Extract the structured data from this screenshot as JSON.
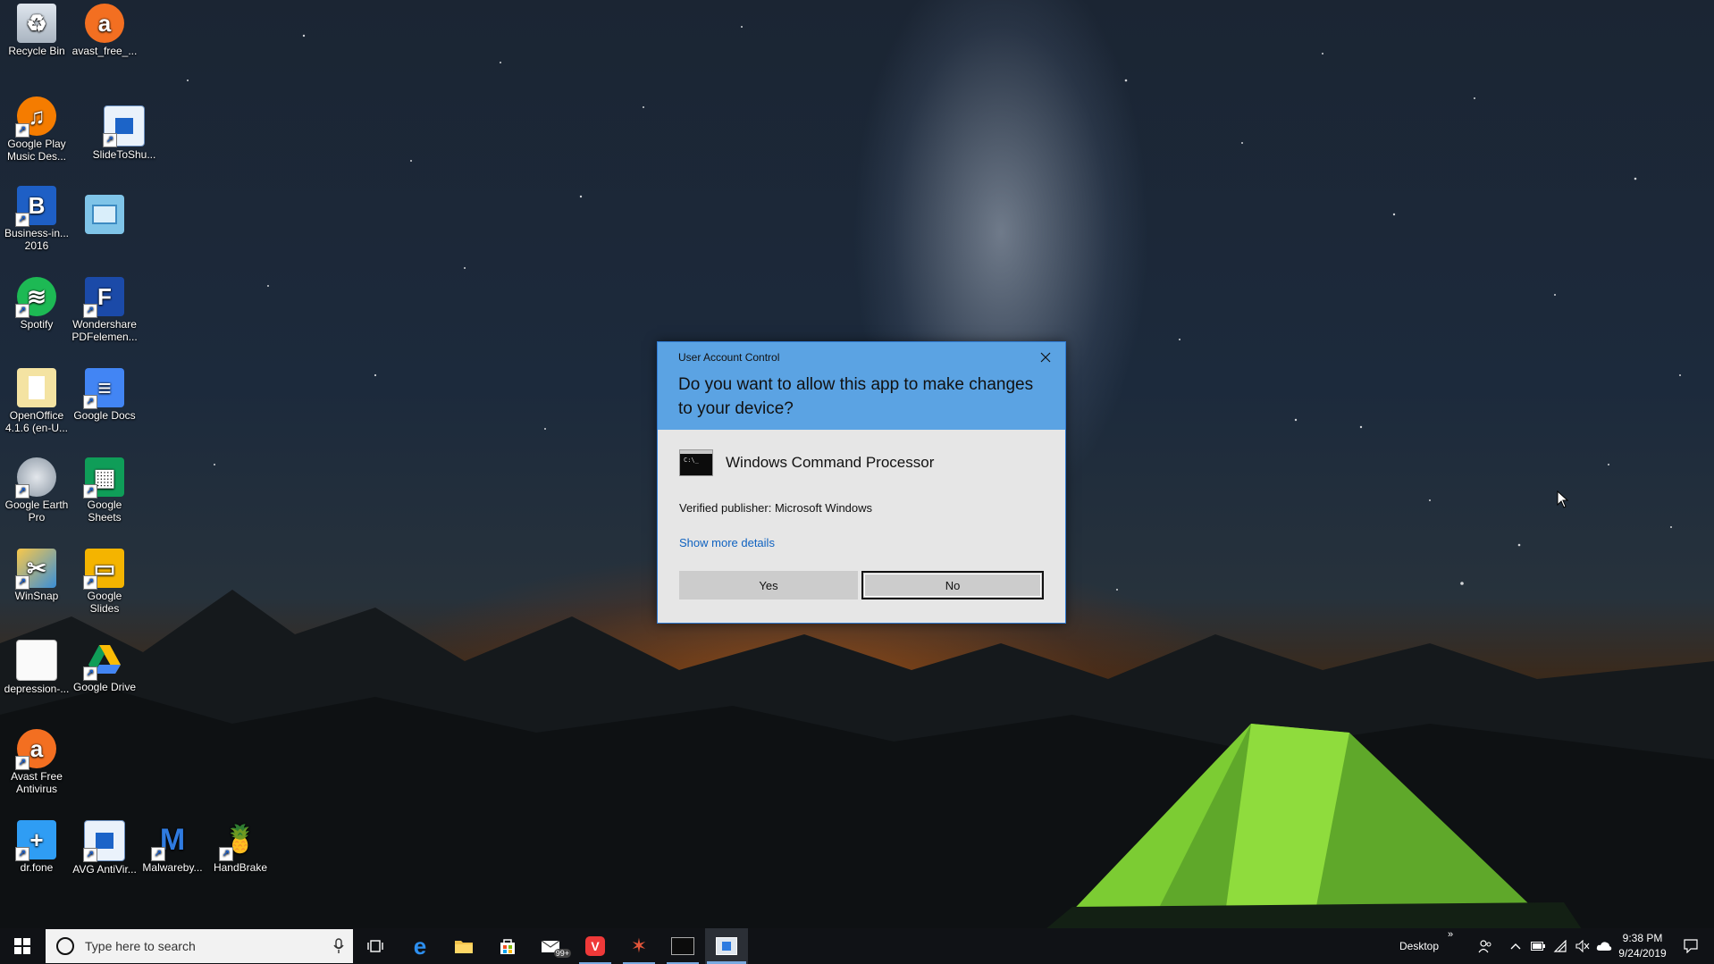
{
  "window": {
    "title": "User Account Control"
  },
  "dialog": {
    "title": "User Account Control",
    "question": "Do you want to allow this app to make changes to your device?",
    "app_name": "Windows Command Processor",
    "app_icon": "cmd-icon",
    "publisher": "Verified publisher: Microsoft Windows",
    "show_more": "Show more details",
    "yes_label": "Yes",
    "no_label": "No",
    "close_icon": "close-icon",
    "header_color": "#5ba3e3",
    "body_color": "#e6e6e6",
    "link_color": "#0f62c0"
  },
  "desktop": {
    "icons": [
      {
        "label": "Recycle Bin",
        "icon": "recycle-bin-icon"
      },
      {
        "label": "avast_free_...",
        "icon": "avast-installer-icon"
      },
      {
        "label": "Google Play Music Des...",
        "icon": "google-play-music-icon"
      },
      {
        "label": "SlideToShu...",
        "icon": "shortcut-icon"
      },
      {
        "label": "Business-in... 2016",
        "icon": "business-in-icon"
      },
      {
        "label": "",
        "icon": "control-panel-icon"
      },
      {
        "label": "Spotify",
        "icon": "spotify-icon"
      },
      {
        "label": "Wondershare PDFelemen...",
        "icon": "pdfelement-icon"
      },
      {
        "label": "OpenOffice 4.1.6 (en-U...",
        "icon": "openoffice-icon"
      },
      {
        "label": "Google Docs",
        "icon": "google-docs-icon"
      },
      {
        "label": "Google Earth Pro",
        "icon": "google-earth-icon"
      },
      {
        "label": "Google Sheets",
        "icon": "google-sheets-icon"
      },
      {
        "label": "WinSnap",
        "icon": "winsnap-icon"
      },
      {
        "label": "Google Slides",
        "icon": "google-slides-icon"
      },
      {
        "label": "depression-...",
        "icon": "document-icon"
      },
      {
        "label": "Google Drive",
        "icon": "google-drive-icon"
      },
      {
        "label": "Avast Free Antivirus",
        "icon": "avast-icon"
      },
      {
        "label": "dr.fone",
        "icon": "drfone-icon"
      },
      {
        "label": "AVG AntiVir...",
        "icon": "avg-icon"
      },
      {
        "label": "Malwareby...",
        "icon": "malwarebytes-icon"
      },
      {
        "label": "HandBrake",
        "icon": "handbrake-icon"
      }
    ]
  },
  "taskbar": {
    "search_placeholder": "Type here to search",
    "mail_badge": "99+",
    "desktop_label": "Desktop",
    "time": "9:38 PM",
    "date": "9/24/2019",
    "accent": "#78a9e0"
  }
}
